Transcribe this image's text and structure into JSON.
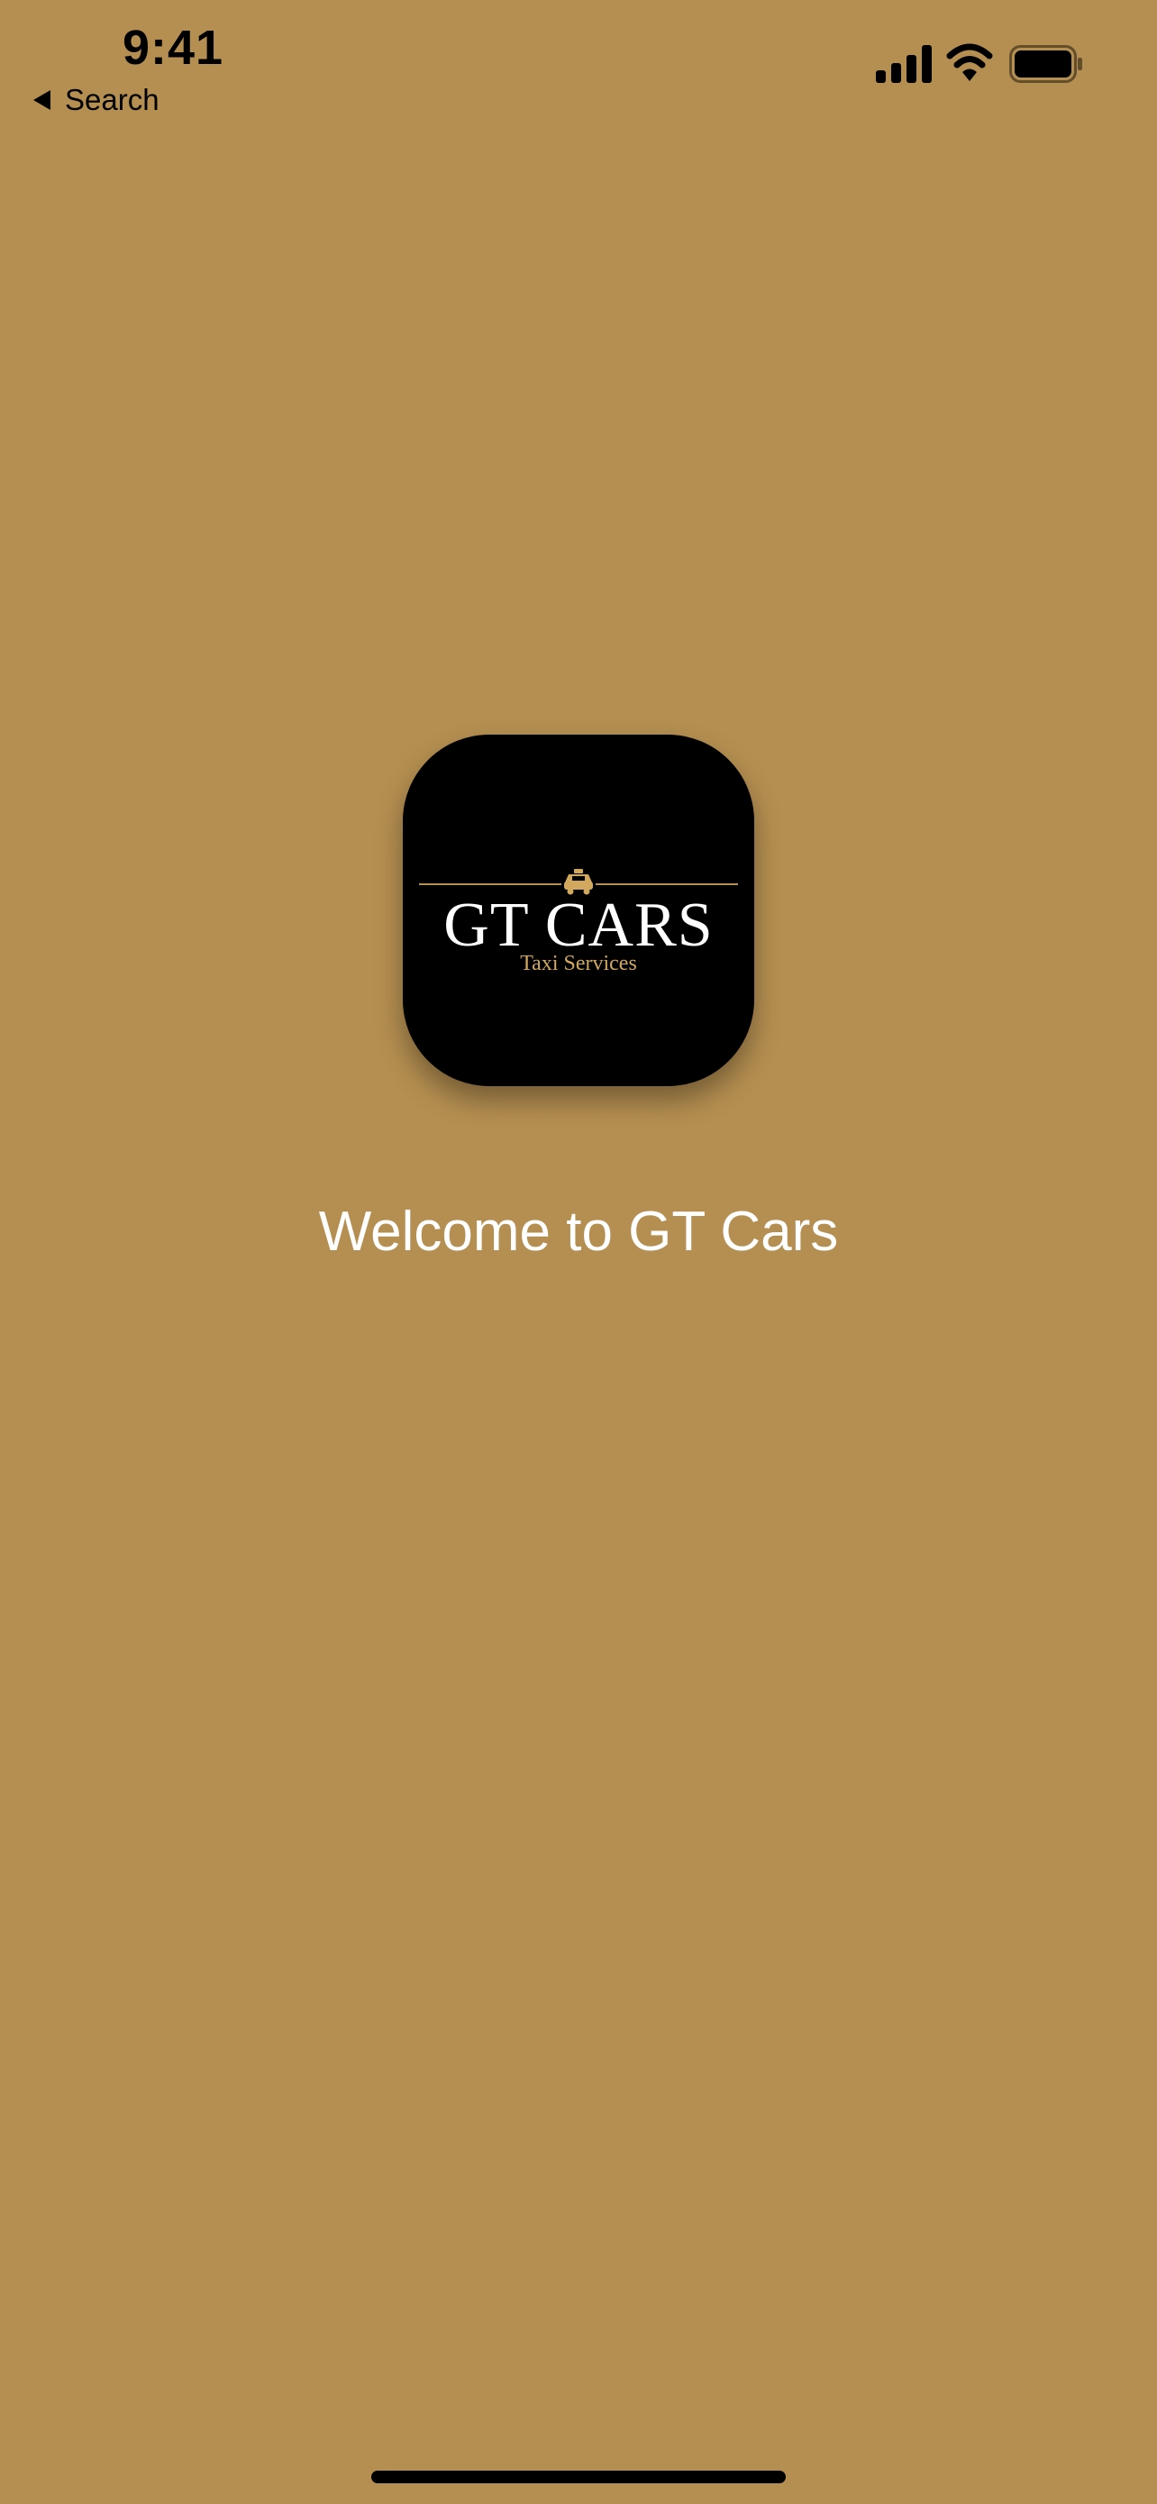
{
  "status_bar": {
    "time": "9:41",
    "back_label": "Search",
    "icons": [
      "back-arrow-icon",
      "cellular-signal-icon",
      "wifi-icon",
      "battery-icon"
    ]
  },
  "app_icon": {
    "title": "GT CARS",
    "subtitle": "Taxi Services",
    "icon": "taxi-icon"
  },
  "welcome": {
    "title": "Welcome to GT Cars"
  },
  "colors": {
    "background": "#b58f51",
    "icon_background": "#000000",
    "accent": "#d2a85e",
    "text": "#ffffff"
  }
}
